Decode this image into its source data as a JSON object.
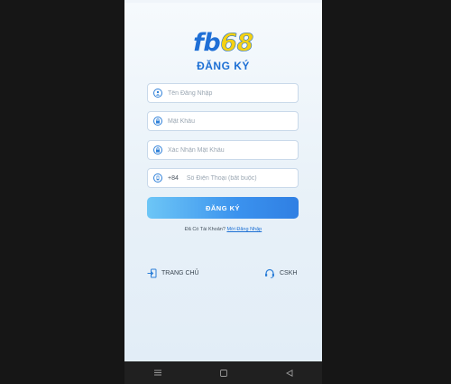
{
  "brand": {
    "logo_fb": "fb",
    "logo_num": "68"
  },
  "form": {
    "title": "ĐĂNG KÝ",
    "username_placeholder": "Tên Đăng Nhập",
    "password_placeholder": "Mật Khẩu",
    "confirm_placeholder": "Xác Nhận Mật Khẩu",
    "phone_prefix": "+84",
    "phone_placeholder": "Số Điện Thoại (bắt buộc)",
    "submit_label": "ĐĂNG KÝ",
    "have_account_text": "Đã Có Tài Khoản?",
    "login_link": "Mời Đăng Nhập"
  },
  "footer": {
    "home_label": "TRANG CHỦ",
    "support_label": "CSKH"
  },
  "colors": {
    "accent": "#1c6fd4",
    "logo_yellow": "#f5d112",
    "button_start": "#6dc6f6",
    "button_end": "#2f7fe3"
  },
  "icons": {
    "username": "user-icon",
    "password": "lock-icon",
    "confirm": "lock-icon",
    "phone": "phone-icon",
    "home": "home-exit-icon",
    "support": "headset-icon",
    "nav_menu": "menu-icon",
    "nav_home": "square-icon",
    "nav_back": "back-triangle-icon"
  }
}
